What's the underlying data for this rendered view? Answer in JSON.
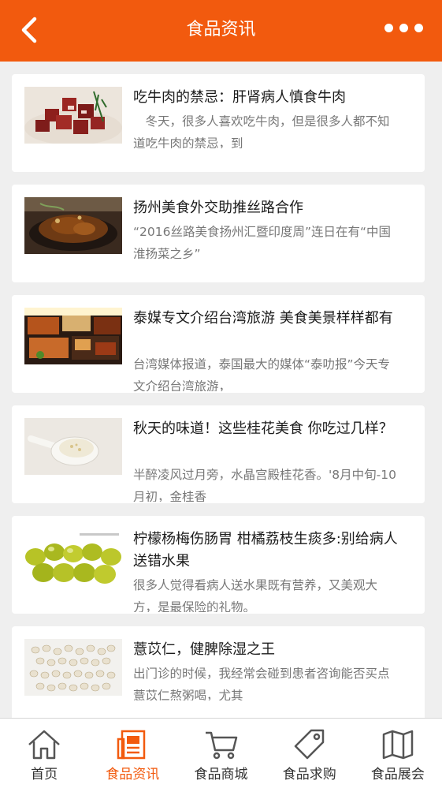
{
  "header": {
    "title": "食品资讯",
    "back_icon": "back-chevron-icon",
    "more_icon": "more-dots-icon",
    "brand_color": "#f25a0e"
  },
  "articles": [
    {
      "title": "吃牛肉的禁忌：肝肾病人慎食牛肉",
      "summary": "　冬天，很多人喜欢吃牛肉，但是很多人都不知道吃牛肉的禁忌，到",
      "image": "beef-cubes-image"
    },
    {
      "title": "扬州美食外交助推丝路合作",
      "summary": "“2016丝路美食扬州汇暨印度周”连日在有“中国淮扬菜之乡”",
      "image": "braised-pork-dish-image"
    },
    {
      "title": "泰媒专文介绍台湾旅游 美食美景样样都有",
      "summary": "台湾媒体报道，泰国最大的媒体“泰叻报”今天专文介绍台湾旅游，",
      "image": "food-stall-image"
    },
    {
      "title": "秋天的味道！这些桂花美食 你吃过几样？",
      "summary": "半醉凌风过月旁，水晶宫殿桂花香。'8月中旬-10月初，金桂香",
      "image": "osmanthus-spoon-image"
    },
    {
      "title": "柠檬杨梅伤肠胃 柑橘荔枝生痰多:别给病人送错水果",
      "summary": "很多人觉得看病人送水果既有营养，又美观大方，是最保险的礼物。",
      "image": "green-fruits-image"
    },
    {
      "title": "薏苡仁，健脾除湿之王",
      "summary": "出门诊的时候，我经常会碰到患者咨询能否买点薏苡仁熬粥喝，尤其",
      "image": "coix-seeds-image"
    }
  ],
  "tabbar": {
    "active_index": 1,
    "active_color": "#f25a0e",
    "items": [
      {
        "label": "首页",
        "icon": "home-icon"
      },
      {
        "label": "食品资讯",
        "icon": "news-icon"
      },
      {
        "label": "食品商城",
        "icon": "cart-icon"
      },
      {
        "label": "食品求购",
        "icon": "tag-icon"
      },
      {
        "label": "食品展会",
        "icon": "map-icon"
      }
    ]
  }
}
